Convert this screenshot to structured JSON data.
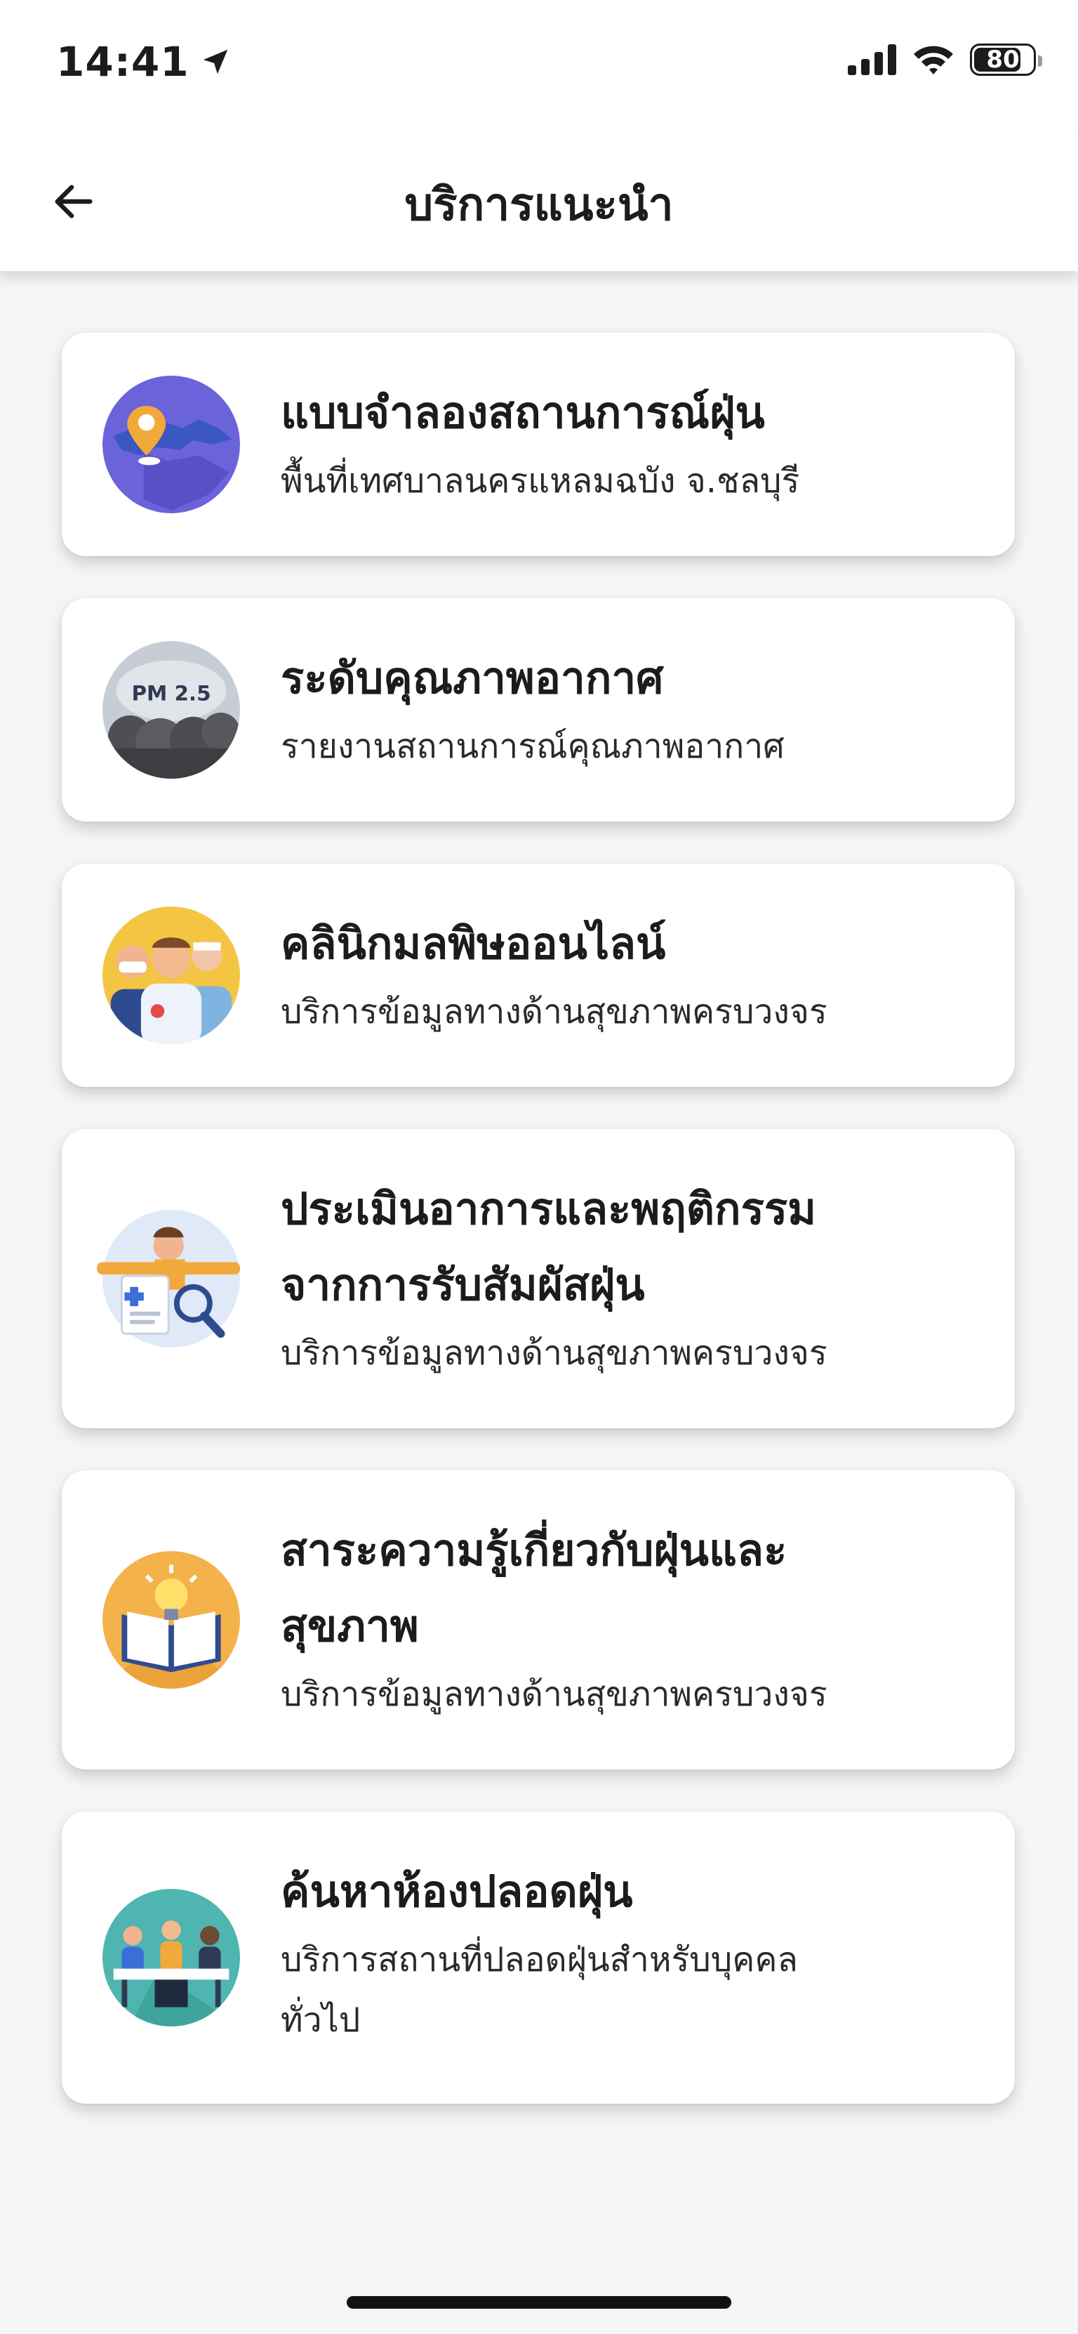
{
  "status_bar": {
    "time": "14:41",
    "battery": "80",
    "battery_level": 0.8
  },
  "header": {
    "title": "บริการแนะนำ"
  },
  "services": [
    {
      "title": "แบบจำลองสถานการณ์ฝุ่น",
      "subtitle": "พื้นที่เทศบาลนครแหลมฉบัง จ.ชลบุรี",
      "icon": "map-pin-icon"
    },
    {
      "title": "ระดับคุณภาพอากาศ",
      "subtitle": "รายงานสถานการณ์คุณภาพอากาศ",
      "icon": "pm25-cloud-icon",
      "icon_label": "PM 2.5"
    },
    {
      "title": "คลินิกมลพิษออนไลน์",
      "subtitle": "บริการข้อมูลทางด้านสุขภาพครบวงจร",
      "icon": "doctors-icon"
    },
    {
      "title": "ประเมินอาการและพฤติกรรม\nจากการรับสัมผัสฝุ่น",
      "subtitle": "บริการข้อมูลทางด้านสุขภาพครบวงจร",
      "icon": "assessment-icon"
    },
    {
      "title": "สาระความรู้เกี่ยวกับฝุ่นและ\nสุขภาพ",
      "subtitle": "บริการข้อมูลทางด้านสุขภาพครบวงจร",
      "icon": "book-lightbulb-icon"
    },
    {
      "title": "ค้นหาห้องปลอดฝุ่น",
      "subtitle": "บริการสถานที่ปลอดฝุ่นสำหรับบุคคล\nทั่วไป",
      "icon": "meeting-room-icon"
    }
  ]
}
